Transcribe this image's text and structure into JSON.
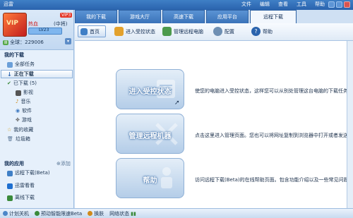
{
  "window": {
    "title": "迅雷"
  },
  "menu": [
    "文件",
    "编辑",
    "查看",
    "工具",
    "帮助"
  ],
  "user": {
    "name": "",
    "avatar_text": "VIP",
    "vip_badge": "VIP3",
    "level": "热血",
    "rank": "(中将)",
    "level_bar": "LV23",
    "score": "全球：229006"
  },
  "sidebar": {
    "my_downloads": "我的下载",
    "items": [
      {
        "label": "全部任务"
      },
      {
        "label": "正在下载"
      },
      {
        "label": "已下载 (5)"
      },
      {
        "label": "影视"
      },
      {
        "label": "音乐"
      },
      {
        "label": "软件"
      },
      {
        "label": "游戏"
      },
      {
        "label": "我的收藏"
      },
      {
        "label": "垃圾箱"
      }
    ],
    "my_apps": "我的应用",
    "apps_add": "添加",
    "apps": [
      {
        "label": "远程下载(Beta)"
      },
      {
        "label": "迅雷看看"
      },
      {
        "label": "离线下载"
      }
    ]
  },
  "tabs": [
    {
      "label": "我的下载"
    },
    {
      "label": "游戏大厅"
    },
    {
      "label": "高速下载"
    },
    {
      "label": "应用平台"
    },
    {
      "label": "远程下载"
    }
  ],
  "toolbar": {
    "home": "首页",
    "enter_control": "进入受控状态",
    "manage_remote": "管理远程电脑",
    "settings": "配置",
    "help": "帮助"
  },
  "cards": [
    {
      "label": "进入受控状态",
      "desc": "使您的电脑进入受控状态，这样您可以从别处管理这台电脑的下载任务。"
    },
    {
      "label": "管理远程机器",
      "desc": "点击这里进入管理页面。您也可以将网址复制到浏览器中打开或者发送给朋友"
    },
    {
      "label": "帮助",
      "desc": "访问远程下载(Beta)的在线帮助页面。包含功能介绍以及一些常见问题解答"
    }
  ],
  "statusbar": {
    "shutdown": "计划关机",
    "smart_speed": "预动智能限速Beta",
    "switch": "换肤",
    "network": "网络状态"
  }
}
